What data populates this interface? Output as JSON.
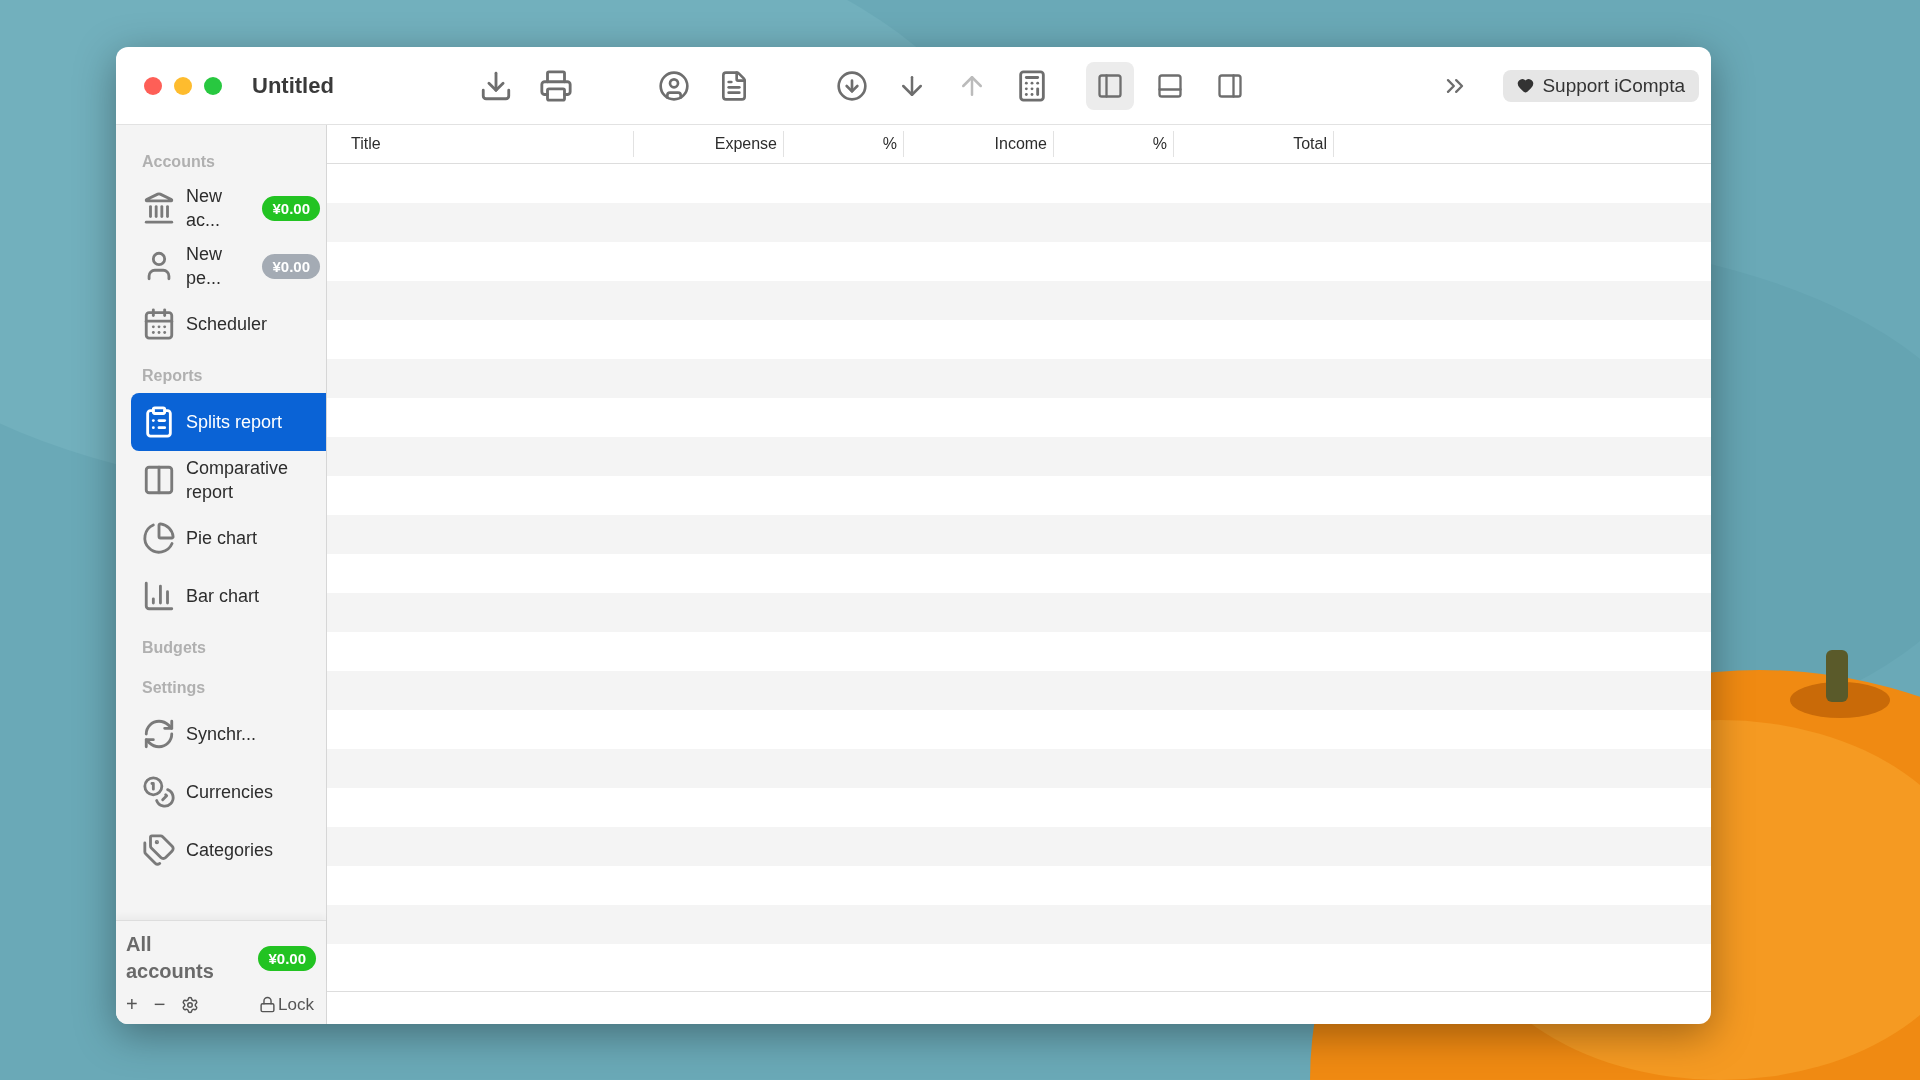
{
  "window": {
    "title": "Untitled"
  },
  "view_buttons": [
    {
      "selected": true
    },
    {
      "selected": false
    },
    {
      "selected": false
    }
  ],
  "support_button": {
    "label": "Support iCompta"
  },
  "sidebar": {
    "sections": [
      {
        "title": "Accounts",
        "items": [
          {
            "label": "New ac...",
            "badge": "¥0.00",
            "color": "#22c322",
            "selected": false
          },
          {
            "label": "New pe...",
            "badge": "¥0.00",
            "color": "#a4abb4",
            "selected": false
          },
          {
            "label": "Scheduler",
            "selected": false
          }
        ]
      },
      {
        "title": "Reports",
        "items": [
          {
            "label": "Splits report",
            "selected": true
          },
          {
            "label": "Comparative report",
            "selected": false
          },
          {
            "label": "Pie chart",
            "selected": false
          },
          {
            "label": "Bar chart",
            "selected": false
          }
        ]
      },
      {
        "title": "Budgets"
      },
      {
        "title": "Settings",
        "items": [
          {
            "label": "Synchr...",
            "selected": false
          },
          {
            "label": "Currencies",
            "selected": false
          },
          {
            "label": "Categories",
            "selected": false
          }
        ]
      }
    ],
    "total": {
      "label": "All accounts",
      "badge": "¥0.00",
      "color": "#22c322"
    },
    "footer": {
      "add": "+",
      "remove": "−",
      "lock": "Lock"
    }
  },
  "table": {
    "columns": [
      "Title",
      "Expense",
      "%",
      "Income",
      "%",
      "Total"
    ]
  }
}
